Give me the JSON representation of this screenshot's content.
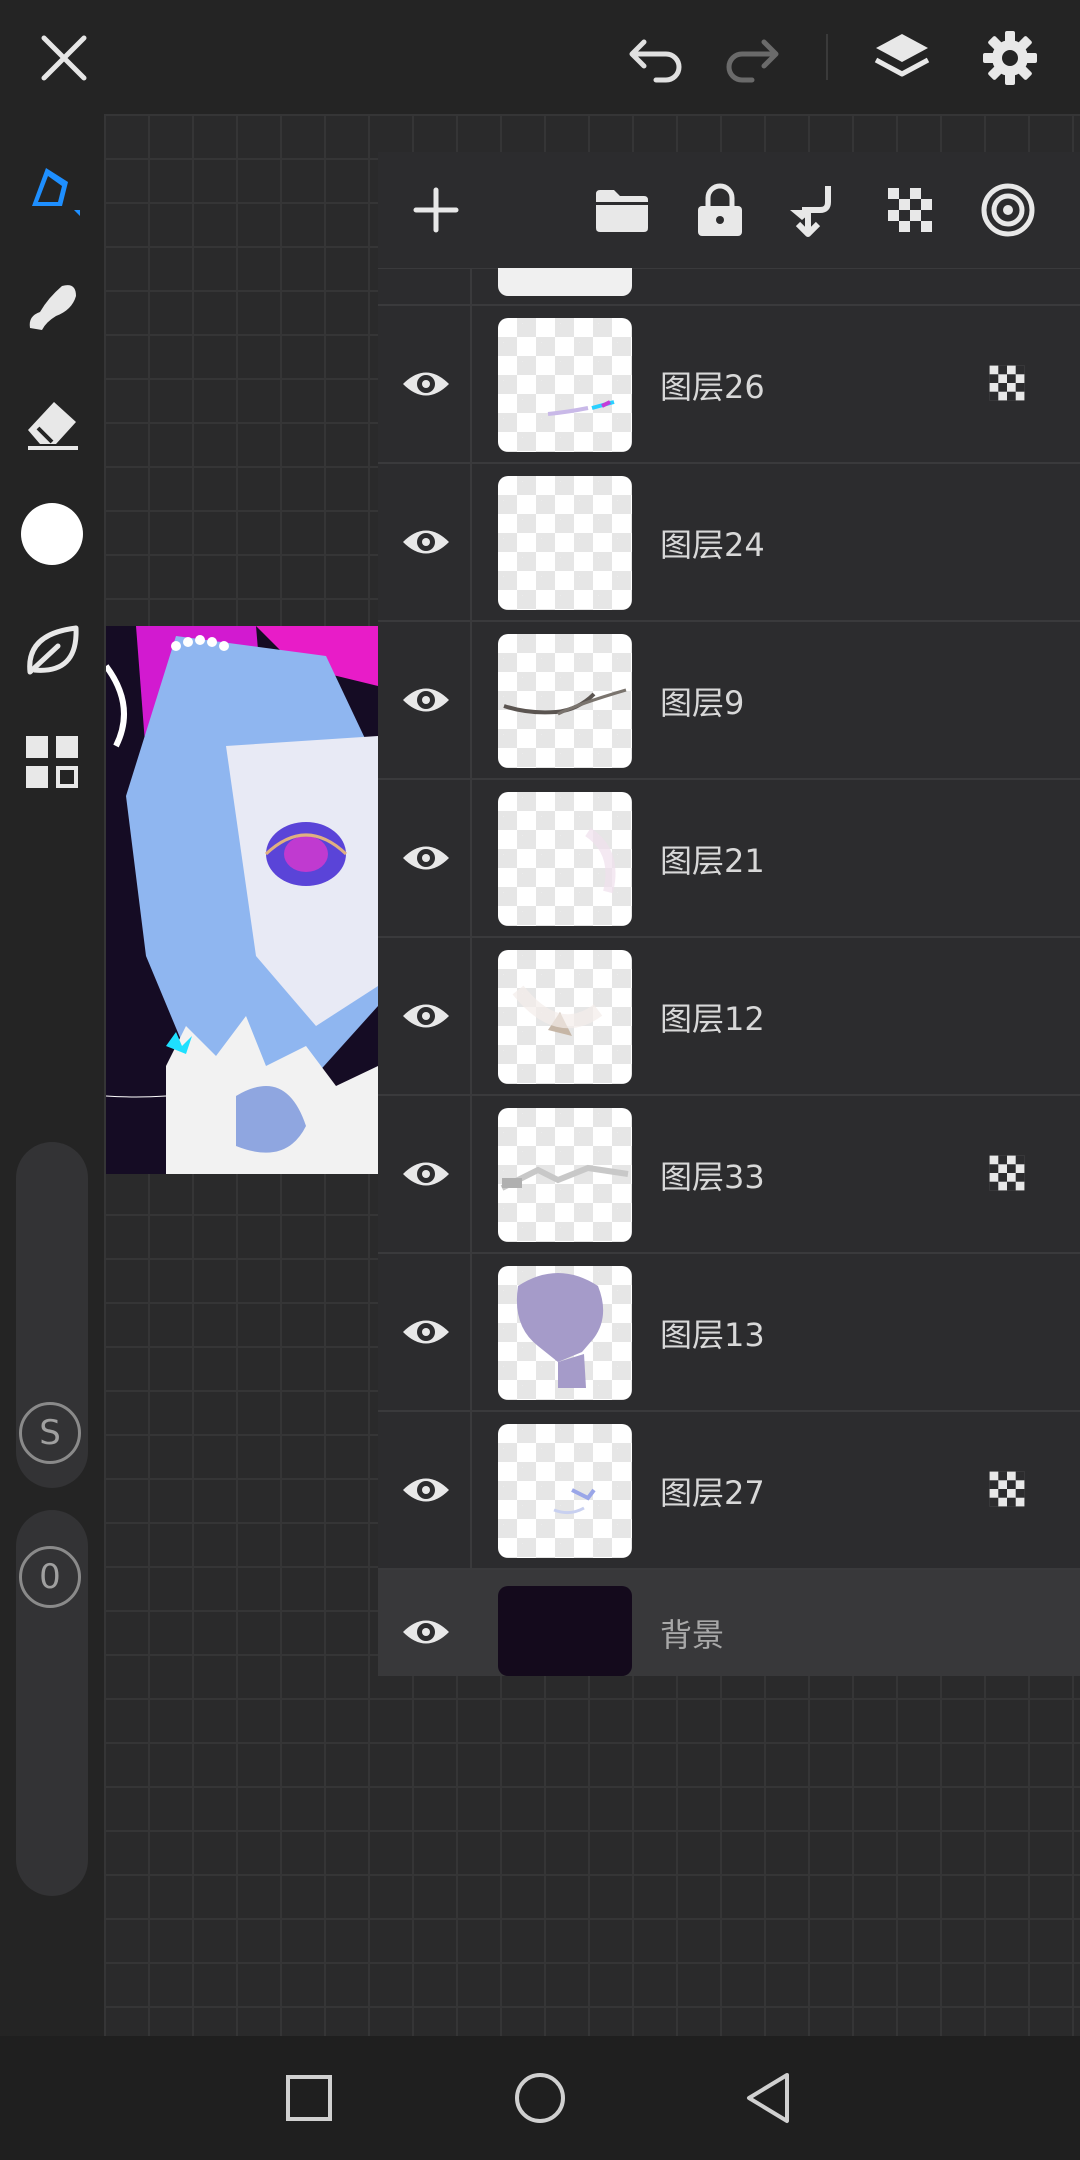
{
  "app": {
    "accent_color": "#1e8fff"
  },
  "topbar": {
    "icons": [
      "close-icon",
      "undo-icon",
      "redo-icon",
      "layers-icon",
      "gear-icon"
    ]
  },
  "tools": {
    "icons": [
      "pen-icon",
      "smudge-icon",
      "eraser-icon",
      "color-swatch-icon",
      "leaf-icon",
      "grid-menu-icon"
    ],
    "brush_size_label": "S",
    "opacity_label": "0",
    "current_color": "#ffffff"
  },
  "layer_panel": {
    "toolbar_icons": [
      "add-layer-icon",
      "folder-icon",
      "lock-icon",
      "merge-down-icon",
      "alpha-lock-icon",
      "blend-icon"
    ],
    "layers": [
      {
        "name": "图层26",
        "clipped": true,
        "visible": true
      },
      {
        "name": "图层24",
        "clipped": false,
        "visible": true
      },
      {
        "name": "图层9",
        "clipped": false,
        "visible": true
      },
      {
        "name": "图层21",
        "clipped": false,
        "visible": true
      },
      {
        "name": "图层12",
        "clipped": false,
        "visible": true
      },
      {
        "name": "图层33",
        "clipped": true,
        "visible": true
      },
      {
        "name": "图层13",
        "clipped": false,
        "visible": true
      },
      {
        "name": "图层27",
        "clipped": true,
        "visible": true
      },
      {
        "name": "背景",
        "clipped": false,
        "visible": true,
        "selected": true
      }
    ]
  },
  "navbar": {
    "icons": [
      "recent-apps-icon",
      "home-icon",
      "back-icon"
    ]
  }
}
